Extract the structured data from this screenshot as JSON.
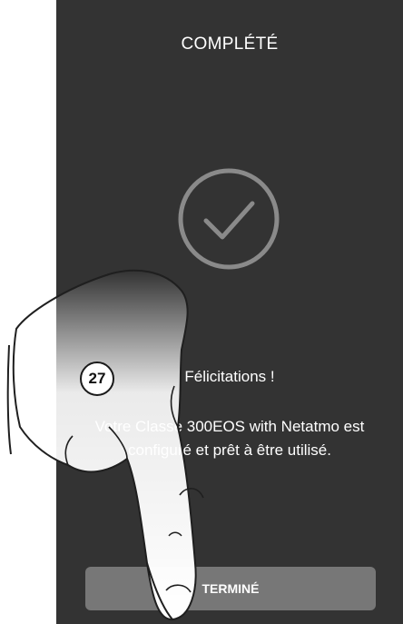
{
  "screen": {
    "title": "COMPLÉTÉ",
    "status_icon": "check-circle-icon",
    "congrats": "Félicitations !",
    "message_line1": "Votre Classe 300EOS with Netatmo est",
    "message_line2": "configuré et prêt à être utilisé.",
    "done_label": "TERMINÉ"
  },
  "annotation": {
    "step_number": "27"
  },
  "colors": {
    "screen_bg": "#333333",
    "button_bg": "#777777",
    "icon_stroke": "#8a8a8a",
    "text": "#ffffff"
  }
}
